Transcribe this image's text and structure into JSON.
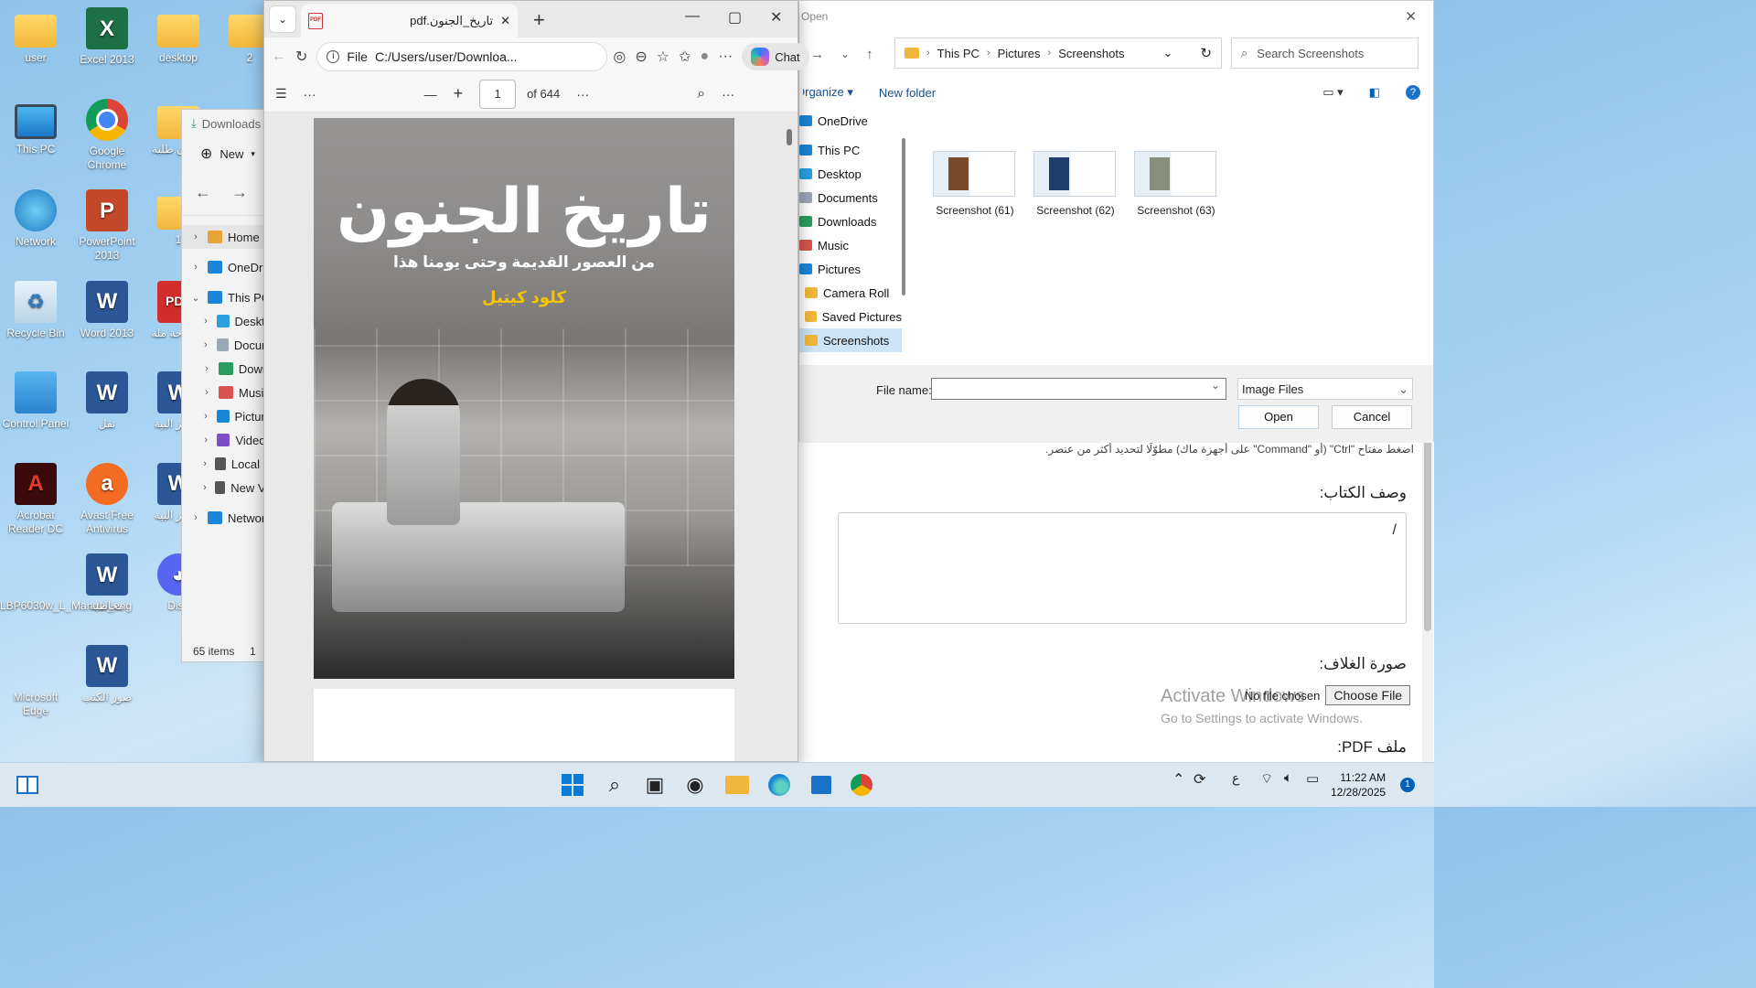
{
  "desktop": {
    "icons": [
      {
        "label": "user",
        "icon": "user-folder-icon"
      },
      {
        "label": "Excel 2013",
        "icon": "excel-icon"
      },
      {
        "label": "desktop",
        "icon": "folder-icon"
      },
      {
        "label": "2",
        "icon": "folder-icon"
      },
      {
        "label": "This PC",
        "icon": "monitor-icon"
      },
      {
        "label": "Google Chrome",
        "icon": "chrome-icon"
      },
      {
        "label": "شؤون طلبة",
        "icon": "folder-icon"
      },
      {
        "label": "Network",
        "icon": "network-icon"
      },
      {
        "label": "PowerPoint 2013",
        "icon": "powerpoint-icon"
      },
      {
        "label": "1",
        "icon": "folder-icon"
      },
      {
        "label": "Recycle Bin",
        "icon": "recycle-bin-icon"
      },
      {
        "label": "Word 2013",
        "icon": "word-icon"
      },
      {
        "label": "أطروحة ملة",
        "icon": "pdf-icon"
      },
      {
        "label": "Control Panel",
        "icon": "control-panel-icon"
      },
      {
        "label": "نقل",
        "icon": "word-doc-icon"
      },
      {
        "label": "مراكز البية",
        "icon": "word-doc-icon"
      },
      {
        "label": "Acrobat Reader DC",
        "icon": "acrobat-icon"
      },
      {
        "label": "Avast Free Antivirus",
        "icon": "avast-icon"
      },
      {
        "label": "مراكز البية",
        "icon": "word-doc-icon"
      },
      {
        "label": "LBP6030w_L_Manual_eng",
        "icon": "edge-icon"
      },
      {
        "label": "مخاطبة",
        "icon": "word-doc-icon"
      },
      {
        "label": "Disc",
        "icon": "discord-icon"
      },
      {
        "label": "Microsoft Edge",
        "icon": "edge-icon"
      },
      {
        "label": "صور الكتب",
        "icon": "word-doc-icon"
      }
    ]
  },
  "explorer": {
    "title": "Downloads",
    "new_label": "New",
    "tree": [
      {
        "label": "Home",
        "level": 0
      },
      {
        "label": "OneDriv",
        "level": 0
      },
      {
        "label": "This PC",
        "level": 0
      },
      {
        "label": "Deskto",
        "level": 1
      },
      {
        "label": "Docum",
        "level": 1
      },
      {
        "label": "Downl",
        "level": 1
      },
      {
        "label": "Music",
        "level": 1
      },
      {
        "label": "Picture",
        "level": 1
      },
      {
        "label": "Videos",
        "level": 1
      },
      {
        "label": "Local D",
        "level": 1
      },
      {
        "label": "New Vc",
        "level": 1
      },
      {
        "label": "Network",
        "level": 0
      }
    ],
    "status_items": "65 items",
    "status_selected": "1"
  },
  "edge": {
    "tab_title": "تاريخ_الجنون.pdf",
    "address_prefix": "File",
    "url": "C:/Users/user/Downloa...",
    "chat_label": "Chat",
    "page_current": "1",
    "page_total": "of 644",
    "cover": {
      "title": "تاريخ الجنون",
      "subtitle": "من العصور القديمة وحتى يومنا هذا",
      "author": "كلود كيتيل"
    }
  },
  "dialog": {
    "title": "Open",
    "breadcrumb": [
      "This PC",
      "Pictures",
      "Screenshots"
    ],
    "search_placeholder": "Search Screenshots",
    "organize_label": "Organize",
    "new_folder_label": "New folder",
    "nav": [
      {
        "label": "OneDrive",
        "indent": 0,
        "selected": false
      },
      {
        "label": "This PC",
        "indent": 0,
        "selected": false
      },
      {
        "label": "Desktop",
        "indent": 1,
        "selected": false
      },
      {
        "label": "Documents",
        "indent": 1,
        "selected": false
      },
      {
        "label": "Downloads",
        "indent": 1,
        "selected": false
      },
      {
        "label": "Music",
        "indent": 1,
        "selected": false
      },
      {
        "label": "Pictures",
        "indent": 1,
        "selected": false
      },
      {
        "label": "Camera Roll",
        "indent": 2,
        "selected": false
      },
      {
        "label": "Saved Pictures",
        "indent": 2,
        "selected": false
      },
      {
        "label": "Screenshots",
        "indent": 2,
        "selected": true
      }
    ],
    "files": [
      "Screenshot (61)",
      "Screenshot (62)",
      "Screenshot (63)"
    ],
    "file_name_label": "File name:",
    "file_name_value": "",
    "filter": "Image Files",
    "open_label": "Open",
    "cancel_label": "Cancel"
  },
  "webform": {
    "hint": "اضغط مفتاح \"Ctrl\" (أو \"Command\" على أجهزة ماك) مطوّلًا لتحديد أكثر من عنصر.",
    "description_label": "وصف الكتاب:",
    "description_value": "/",
    "cover_label": "صورة الغلاف:",
    "choose_file": "Choose File",
    "no_file": "No file chosen",
    "pdf_label": "ملف PDF:",
    "activate_line1": "Activate Windows",
    "activate_line2": "Go to Settings to activate Windows."
  },
  "taskbar": {
    "time": "11:22 AM",
    "date": "12/28/2025",
    "notifications": "1",
    "language": "ع"
  }
}
